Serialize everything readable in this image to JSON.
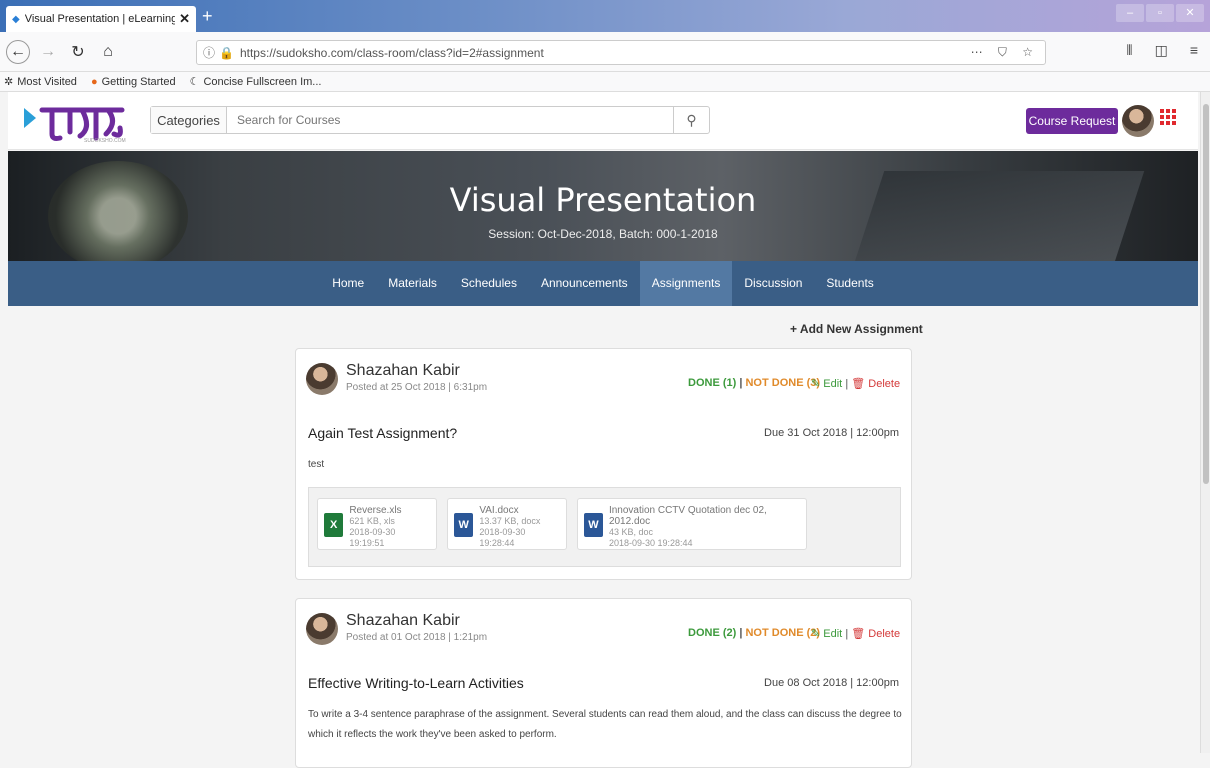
{
  "browser": {
    "tab_title": "Visual Presentation | eLearning",
    "url_domain": "https://sudoksho.com",
    "url_path": "/class-room/class?id=2#assignment",
    "bookmarks": [
      "Most Visited",
      "Getting Started",
      "Concise Fullscreen Im..."
    ]
  },
  "header": {
    "categories_label": "Categories",
    "search_placeholder": "Search for Courses",
    "course_request_label": "Course Request"
  },
  "banner": {
    "title": "Visual Presentation",
    "subtitle": "Session: Oct-Dec-2018, Batch: 000-1-2018"
  },
  "class_nav": {
    "items": [
      "Home",
      "Materials",
      "Schedules",
      "Announcements",
      "Assignments",
      "Discussion",
      "Students"
    ],
    "active": "Assignments"
  },
  "add_new_label": "+ Add New Assignment",
  "assignments": [
    {
      "author": "Shazahan Kabir",
      "posted": "Posted at 25 Oct 2018 | 6:31pm",
      "done": "DONE (1)",
      "not_done": "NOT DONE (3)",
      "edit": "Edit",
      "delete": "Delete",
      "title": "Again Test Assignment?",
      "due": "Due 31 Oct 2018 | 12:00pm",
      "description": "test",
      "files": [
        {
          "name": "Reverse.xls",
          "size": "621 KB, xls",
          "date": "2018-09-30 19:19:51",
          "type": "xls"
        },
        {
          "name": "VAI.docx",
          "size": "13.37 KB, docx",
          "date": "2018-09-30 19:28:44",
          "type": "doc"
        },
        {
          "name": "Innovation CCTV Quotation dec 02, 2012.doc",
          "size": "43 KB, doc",
          "date": "2018-09-30 19:28:44",
          "type": "doc"
        }
      ]
    },
    {
      "author": "Shazahan Kabir",
      "posted": "Posted at 01 Oct 2018 | 1:21pm",
      "done": "DONE (2)",
      "not_done": "NOT DONE (2)",
      "edit": "Edit",
      "delete": "Delete",
      "title": "Effective Writing-to-Learn Activities",
      "due": "Due 08 Oct 2018 | 12:00pm",
      "description_line1": "To write a 3-4 sentence paraphrase of the assignment. Several students can read them aloud, and the class can discuss the degree to",
      "description_line2": "which it reflects the work they've been asked to perform."
    }
  ]
}
